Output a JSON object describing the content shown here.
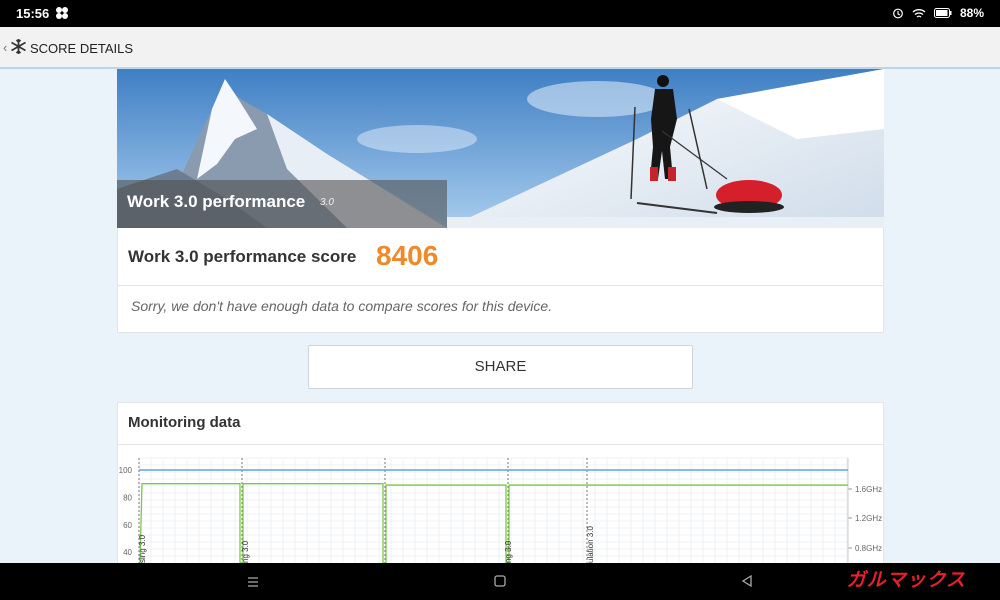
{
  "status_bar": {
    "time": "15:56",
    "battery": "88%",
    "icons": [
      "app-logo-icon",
      "alarm-icon",
      "wifi-icon",
      "battery-icon"
    ]
  },
  "app_bar": {
    "title": "SCORE DETAILS",
    "icons": [
      "back-icon",
      "app-logo-icon"
    ]
  },
  "hero": {
    "title": "Work 3.0 performance",
    "version": "3.0"
  },
  "score": {
    "label": "Work 3.0 performance score",
    "value": "8406",
    "compare_message": "Sorry, we don't have enough data to compare scores for this device."
  },
  "share": {
    "label": "SHARE"
  },
  "monitoring": {
    "title": "Monitoring data"
  },
  "chart_data": {
    "type": "line",
    "y_left_ticks": [
      "100",
      "80",
      "60",
      "40"
    ],
    "y_right_ticks": [
      "1.6GHz",
      "1.2GHz",
      "0.8GHz"
    ],
    "segment_labels": [
      "sing 3.0",
      "ng 3.0",
      "ng 3.0",
      "ulation 3.0"
    ],
    "series": [
      {
        "values": [
          100,
          100,
          100,
          100,
          100
        ]
      },
      {
        "values": [
          90,
          90,
          89,
          89,
          88
        ]
      }
    ],
    "colors": {
      "blue": "#5aa6e6",
      "green": "#7cc84a"
    },
    "grid": true
  },
  "nav_bar": {
    "icons": [
      "recent-apps-icon",
      "home-icon",
      "back-nav-icon"
    ]
  },
  "watermark": "ガルマックス",
  "colors": {
    "accent": "#f0892a",
    "page_bg": "#eaf3fa"
  }
}
